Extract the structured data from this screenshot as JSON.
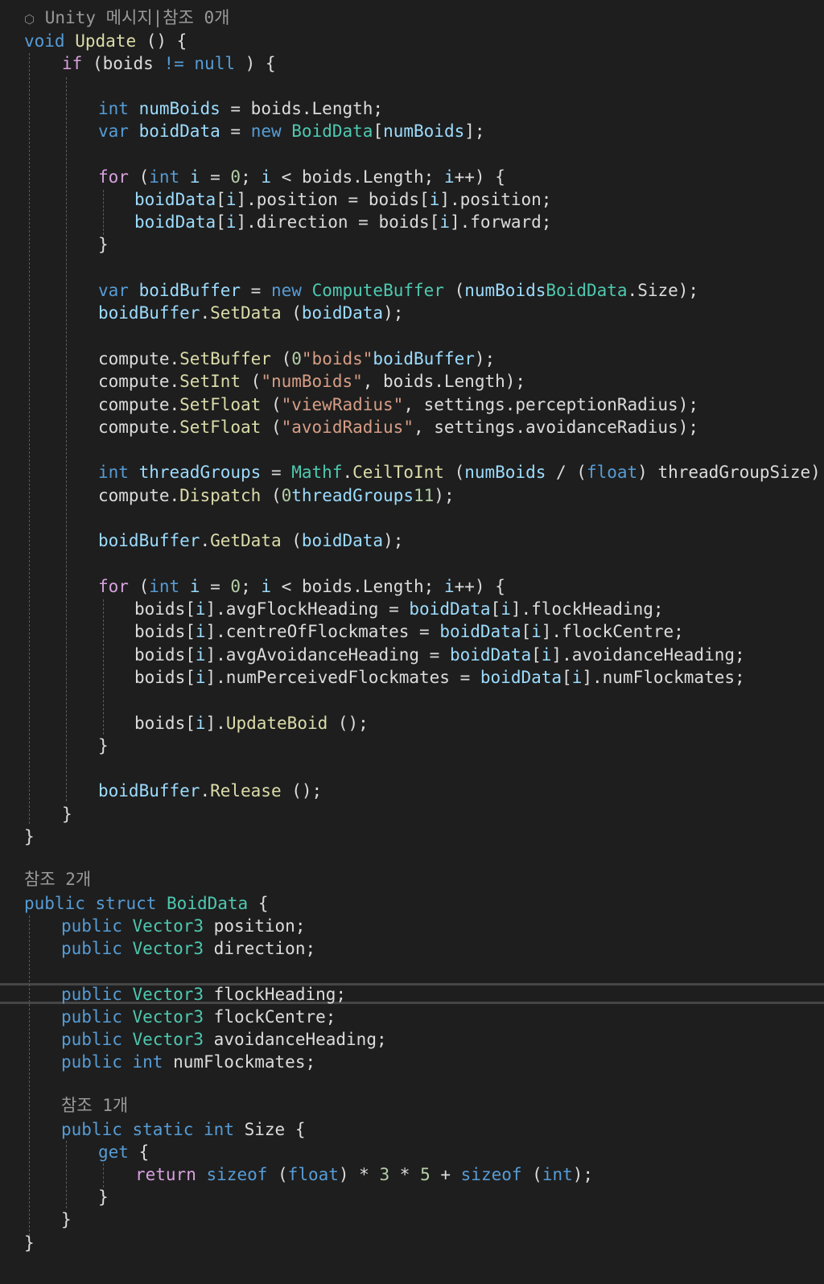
{
  "code_lens": {
    "update": "Unity 메시지|참조 0개",
    "struct": "참조 2개",
    "size": "참조 1개"
  },
  "icons": {
    "unity_message": "unity-cube-icon"
  },
  "colors": {
    "background": "#1e1e1e",
    "keyword": "#569cd6",
    "control_keyword": "#d8a0df",
    "type": "#4ec9b0",
    "method": "#dcdcaa",
    "local_variable": "#9cdcfe",
    "string": "#d69d85",
    "number": "#b5cea8",
    "plain": "#dcdcdc",
    "code_lens": "#999999"
  },
  "lines": [
    [
      [
        "kw",
        "void"
      ],
      [
        "",
        " "
      ],
      [
        "mth",
        "Update"
      ],
      [
        "",
        " () {"
      ]
    ],
    [
      [
        "ctl",
        "if"
      ],
      [
        "",
        " (boids "
      ],
      [
        "kw",
        "!="
      ],
      [
        "",
        " "
      ],
      [
        "kw",
        "null"
      ],
      [
        "",
        " ) {"
      ]
    ],
    [
      [
        "kw",
        "int"
      ],
      [
        "",
        " "
      ],
      [
        "loc",
        "numBoids"
      ],
      [
        "",
        " = boids.Length;"
      ]
    ],
    [
      [
        "kw",
        "var"
      ],
      [
        "",
        " "
      ],
      [
        "loc",
        "boidData"
      ],
      [
        "",
        " = "
      ],
      [
        "kw",
        "new"
      ],
      [
        "",
        " "
      ],
      [
        "typ",
        "BoidData"
      ],
      [
        "",
        "["
      ],
      [
        "loc",
        "numBoids"
      ],
      [
        "",
        "];"
      ]
    ],
    [
      [
        "ctl",
        "for"
      ],
      [
        "",
        " ("
      ],
      [
        "kw",
        "int"
      ],
      [
        "",
        " "
      ],
      [
        "loc",
        "i"
      ],
      [
        "",
        " = "
      ],
      [
        "num",
        "0"
      ],
      [
        "",
        "; "
      ],
      [
        "loc",
        "i"
      ],
      [
        "",
        " < boids.Length; "
      ],
      [
        "loc",
        "i"
      ],
      [
        "",
        "++) {"
      ]
    ],
    [
      [
        "loc",
        "boidData"
      ],
      [
        "",
        "["
      ],
      [
        "loc",
        "i"
      ],
      [
        "",
        "].position = boids["
      ],
      [
        "loc",
        "i"
      ],
      [
        "",
        "].position;"
      ]
    ],
    [
      [
        "loc",
        "boidData"
      ],
      [
        "",
        "["
      ],
      [
        "loc",
        "i"
      ],
      [
        "",
        "].direction = boids["
      ],
      [
        "loc",
        "i"
      ],
      [
        "",
        "].forward;"
      ]
    ],
    [
      [
        "",
        "}"
      ]
    ],
    [
      [
        "kw",
        "var"
      ],
      [
        "",
        " "
      ],
      [
        "loc",
        "boidBuffer"
      ],
      [
        "",
        " = "
      ],
      [
        "kw",
        "new"
      ],
      [
        "",
        " "
      ],
      [
        "typ",
        "ComputeBuffer"
      ],
      [
        "",
        " ("
      ],
      [
        "loc",
        "numBoids"
      ],
      [
        ", "
      ],
      [
        "typ",
        "BoidData"
      ],
      [
        "",
        ".Size);"
      ]
    ],
    [
      [
        "loc",
        "boidBuffer"
      ],
      [
        "",
        "."
      ],
      [
        "mth",
        "SetData"
      ],
      [
        "",
        " ("
      ],
      [
        "loc",
        "boidData"
      ],
      [
        "",
        ");"
      ]
    ],
    [
      [
        "",
        "compute."
      ],
      [
        "mth",
        "SetBuffer"
      ],
      [
        "",
        " ("
      ],
      [
        "num",
        "0"
      ],
      [
        ", "
      ],
      [
        "str",
        "\"boids\""
      ],
      [
        ", "
      ],
      [
        "loc",
        "boidBuffer"
      ],
      [
        "",
        ");"
      ]
    ],
    [
      [
        "",
        "compute."
      ],
      [
        "mth",
        "SetInt"
      ],
      [
        "",
        " ("
      ],
      [
        "str",
        "\"numBoids\""
      ],
      [
        "",
        ", boids.Length);"
      ]
    ],
    [
      [
        "",
        "compute."
      ],
      [
        "mth",
        "SetFloat"
      ],
      [
        "",
        " ("
      ],
      [
        "str",
        "\"viewRadius\""
      ],
      [
        "",
        ", settings.perceptionRadius);"
      ]
    ],
    [
      [
        "",
        "compute."
      ],
      [
        "mth",
        "SetFloat"
      ],
      [
        "",
        " ("
      ],
      [
        "str",
        "\"avoidRadius\""
      ],
      [
        "",
        ", settings.avoidanceRadius);"
      ]
    ],
    [
      [
        "kw",
        "int"
      ],
      [
        "",
        " "
      ],
      [
        "loc",
        "threadGroups"
      ],
      [
        "",
        " = "
      ],
      [
        "typ",
        "Mathf"
      ],
      [
        "",
        "."
      ],
      [
        "mth",
        "CeilToInt"
      ],
      [
        "",
        " ("
      ],
      [
        "loc",
        "numBoids"
      ],
      [
        "",
        " / ("
      ],
      [
        "kw",
        "float"
      ],
      [
        "",
        ") threadGroupSize);"
      ]
    ],
    [
      [
        "",
        "compute."
      ],
      [
        "mth",
        "Dispatch"
      ],
      [
        "",
        " ("
      ],
      [
        "num",
        "0"
      ],
      [
        ", "
      ],
      [
        "loc",
        "threadGroups"
      ],
      [
        ", "
      ],
      [
        "num",
        "1"
      ],
      [
        ", "
      ],
      [
        "num",
        "1"
      ],
      [
        "",
        ");"
      ]
    ],
    [
      [
        "loc",
        "boidBuffer"
      ],
      [
        "",
        "."
      ],
      [
        "mth",
        "GetData"
      ],
      [
        "",
        " ("
      ],
      [
        "loc",
        "boidData"
      ],
      [
        "",
        ");"
      ]
    ],
    [
      [
        "ctl",
        "for"
      ],
      [
        "",
        " ("
      ],
      [
        "kw",
        "int"
      ],
      [
        "",
        " "
      ],
      [
        "loc",
        "i"
      ],
      [
        "",
        " = "
      ],
      [
        "num",
        "0"
      ],
      [
        "",
        "; "
      ],
      [
        "loc",
        "i"
      ],
      [
        "",
        " < boids.Length; "
      ],
      [
        "loc",
        "i"
      ],
      [
        "",
        "++) {"
      ]
    ],
    [
      [
        "",
        "boids["
      ],
      [
        "loc",
        "i"
      ],
      [
        "",
        "].avgFlockHeading = "
      ],
      [
        "loc",
        "boidData"
      ],
      [
        "",
        "["
      ],
      [
        "loc",
        "i"
      ],
      [
        "",
        "].flockHeading;"
      ]
    ],
    [
      [
        "",
        "boids["
      ],
      [
        "loc",
        "i"
      ],
      [
        "",
        "].centreOfFlockmates = "
      ],
      [
        "loc",
        "boidData"
      ],
      [
        "",
        "["
      ],
      [
        "loc",
        "i"
      ],
      [
        "",
        "].flockCentre;"
      ]
    ],
    [
      [
        "",
        "boids["
      ],
      [
        "loc",
        "i"
      ],
      [
        "",
        "].avgAvoidanceHeading = "
      ],
      [
        "loc",
        "boidData"
      ],
      [
        "",
        "["
      ],
      [
        "loc",
        "i"
      ],
      [
        "",
        "].avoidanceHeading;"
      ]
    ],
    [
      [
        "",
        "boids["
      ],
      [
        "loc",
        "i"
      ],
      [
        "",
        "].numPerceivedFlockmates = "
      ],
      [
        "loc",
        "boidData"
      ],
      [
        "",
        "["
      ],
      [
        "loc",
        "i"
      ],
      [
        "",
        "].numFlockmates;"
      ]
    ],
    [
      [
        "",
        "boids["
      ],
      [
        "loc",
        "i"
      ],
      [
        "",
        "]."
      ],
      [
        "mth",
        "UpdateBoid"
      ],
      [
        "",
        " ();"
      ]
    ],
    [
      [
        "",
        "}"
      ]
    ],
    [
      [
        "loc",
        "boidBuffer"
      ],
      [
        "",
        "."
      ],
      [
        "mth",
        "Release"
      ],
      [
        "",
        " ();"
      ]
    ],
    [
      [
        "",
        "}"
      ]
    ],
    [
      [
        "",
        "}"
      ]
    ],
    [
      [
        "kw",
        "public"
      ],
      [
        "",
        " "
      ],
      [
        "kw",
        "struct"
      ],
      [
        "",
        " "
      ],
      [
        "typ",
        "BoidData"
      ],
      [
        "",
        " {"
      ]
    ],
    [
      [
        "kw",
        "public"
      ],
      [
        "",
        " "
      ],
      [
        "typ",
        "Vector3"
      ],
      [
        "",
        " position;"
      ]
    ],
    [
      [
        "kw",
        "public"
      ],
      [
        "",
        " "
      ],
      [
        "typ",
        "Vector3"
      ],
      [
        "",
        " direction;"
      ]
    ],
    [
      [
        "kw",
        "public"
      ],
      [
        "",
        " "
      ],
      [
        "typ",
        "Vector3"
      ],
      [
        "",
        " flockHeading;"
      ]
    ],
    [
      [
        "kw",
        "public"
      ],
      [
        "",
        " "
      ],
      [
        "typ",
        "Vector3"
      ],
      [
        "",
        " flockCentre;"
      ]
    ],
    [
      [
        "kw",
        "public"
      ],
      [
        "",
        " "
      ],
      [
        "typ",
        "Vector3"
      ],
      [
        "",
        " avoidanceHeading;"
      ]
    ],
    [
      [
        "kw",
        "public"
      ],
      [
        "",
        " "
      ],
      [
        "kw",
        "int"
      ],
      [
        "",
        " numFlockmates;"
      ]
    ],
    [
      [
        "kw",
        "public"
      ],
      [
        "",
        " "
      ],
      [
        "kw",
        "static"
      ],
      [
        "",
        " "
      ],
      [
        "kw",
        "int"
      ],
      [
        "",
        " Size {"
      ]
    ],
    [
      [
        "kw",
        "get"
      ],
      [
        "",
        " {"
      ]
    ],
    [
      [
        "ctl",
        "return"
      ],
      [
        "",
        " "
      ],
      [
        "kw",
        "sizeof"
      ],
      [
        "",
        " ("
      ],
      [
        "kw",
        "float"
      ],
      [
        "",
        ") * "
      ],
      [
        "num",
        "3"
      ],
      [
        "",
        " * "
      ],
      [
        "num",
        "5"
      ],
      [
        "",
        " + "
      ],
      [
        "kw",
        "sizeof"
      ],
      [
        "",
        " ("
      ],
      [
        "kw",
        "int"
      ],
      [
        "",
        ");"
      ]
    ],
    [
      [
        "",
        "}"
      ]
    ],
    [
      [
        "",
        "}"
      ]
    ],
    [
      [
        "",
        "}"
      ]
    ]
  ]
}
